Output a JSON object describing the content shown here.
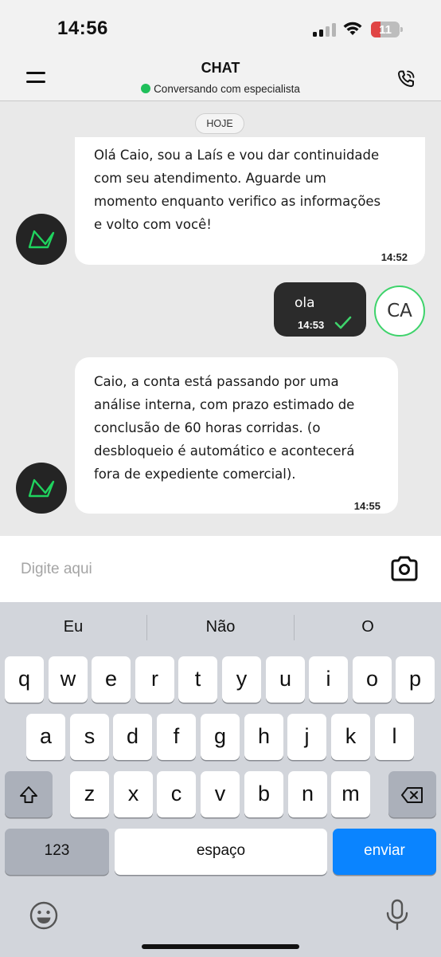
{
  "status_bar": {
    "time": "14:56",
    "battery": "11",
    "battery_level": 0.11
  },
  "header": {
    "title": "CHAT",
    "subtitle": "Conversando com especialista",
    "online_color": "#1fbf5a",
    "menu_icon": "hamburger-menu-icon",
    "call_icon": "phone-call-icon"
  },
  "chat": {
    "date_badge": "HOJE",
    "messages": [
      {
        "direction": "in",
        "lines": [
          "Olá Caio, sou a Laís e vou dar continuidade",
          "com seu atendimento. Aguarde um",
          "momento enquanto verifico as informações",
          "e volto com você!"
        ],
        "time": "14:52"
      },
      {
        "direction": "out",
        "text": "ola",
        "time": "14:53",
        "status_icon": "check-icon",
        "avatar_initials": "CA"
      },
      {
        "direction": "in",
        "lines": [
          "Caio, a conta está passando por uma",
          "análise interna, com prazo estimado de",
          "conclusão de 60 horas corridas. (o",
          "desbloqueio é automático e acontecerá",
          "fora de expediente comercial)."
        ],
        "time": "14:55"
      }
    ]
  },
  "input": {
    "placeholder": "Digite aqui",
    "value": "",
    "camera_icon": "camera-icon"
  },
  "keyboard": {
    "suggestions": [
      "Eu",
      "Não",
      "O"
    ],
    "row1": [
      "q",
      "w",
      "e",
      "r",
      "t",
      "y",
      "u",
      "i",
      "o",
      "p"
    ],
    "row2": [
      "a",
      "s",
      "d",
      "f",
      "g",
      "h",
      "j",
      "k",
      "l"
    ],
    "row3": [
      "z",
      "x",
      "c",
      "v",
      "b",
      "n",
      "m"
    ],
    "numbers_key": "123",
    "space_key": "espaço",
    "send_key": "enviar",
    "accent_color": "#0a84ff"
  }
}
